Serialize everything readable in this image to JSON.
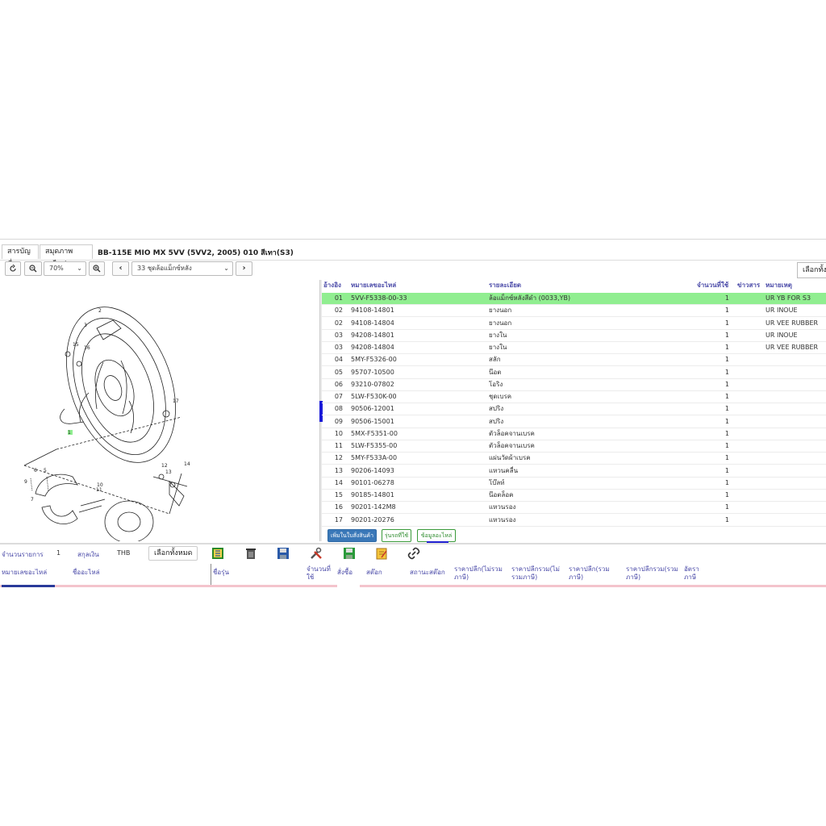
{
  "tabs": [
    "สารบัญชื่อ",
    "สมุดภาพอะไหล่"
  ],
  "model_title": "BB-115E MIO MX 5VV (5VV2, 2005) 010 สีเทา(S3)",
  "toolbar": {
    "zoom": "70%",
    "section": "33 ชุดล้อแม็กซ์หลัง",
    "select_all": "เลือกทั้งหมด"
  },
  "diagram_labels": [
    "2",
    "3",
    "15",
    "16",
    "1",
    "17",
    "12",
    "13",
    "14",
    "11",
    "10",
    "9",
    "6",
    "5",
    "7"
  ],
  "parts_headers": {
    "ref": "อ้างอิง",
    "part_no": "หมายเลขอะไหล่",
    "desc": "รายละเอียด",
    "qty": "จำนวนที่ใช้",
    "news": "ข่าวสาร",
    "note": "หมายเหตุ"
  },
  "parts": [
    {
      "ref": "01",
      "part_no": "5VV-F5338-00-33",
      "desc": "ล้อแม็กซ์หลังสีดำ (0033,YB)",
      "qty": "1",
      "note": "UR YB FOR S3",
      "highlight": true
    },
    {
      "ref": "02",
      "part_no": "94108-14801",
      "desc": "ยางนอก",
      "qty": "1",
      "note": "UR INOUE"
    },
    {
      "ref": "02",
      "part_no": "94108-14804",
      "desc": "ยางนอก",
      "qty": "1",
      "note": "UR VEE RUBBER"
    },
    {
      "ref": "03",
      "part_no": "94208-14801",
      "desc": "ยางใน",
      "qty": "1",
      "note": "UR INOUE"
    },
    {
      "ref": "03",
      "part_no": "94208-14804",
      "desc": "ยางใน",
      "qty": "1",
      "note": "UR VEE RUBBER"
    },
    {
      "ref": "04",
      "part_no": "5MY-F5326-00",
      "desc": "สลัก",
      "qty": "1",
      "note": ""
    },
    {
      "ref": "05",
      "part_no": "95707-10500",
      "desc": "น๊อต",
      "qty": "1",
      "note": ""
    },
    {
      "ref": "06",
      "part_no": "93210-07802",
      "desc": "โอริง",
      "qty": "1",
      "note": ""
    },
    {
      "ref": "07",
      "part_no": "5LW-F530K-00",
      "desc": "ชุดเบรค",
      "qty": "1",
      "note": ""
    },
    {
      "ref": "08",
      "part_no": "90506-12001",
      "desc": "สปริง",
      "qty": "1",
      "note": ""
    },
    {
      "ref": "09",
      "part_no": "90506-15001",
      "desc": "สปริง",
      "qty": "1",
      "note": ""
    },
    {
      "ref": "10",
      "part_no": "5MX-F5351-00",
      "desc": "ตัวล็อคจานเบรค",
      "qty": "1",
      "note": ""
    },
    {
      "ref": "11",
      "part_no": "5LW-F5355-00",
      "desc": "ตัวล็อคจานเบรค",
      "qty": "1",
      "note": ""
    },
    {
      "ref": "12",
      "part_no": "5MY-F533A-00",
      "desc": "แผ่นวัดผ้าเบรค",
      "qty": "1",
      "note": ""
    },
    {
      "ref": "13",
      "part_no": "90206-14093",
      "desc": "แหวนคลื่น",
      "qty": "1",
      "note": ""
    },
    {
      "ref": "14",
      "part_no": "90101-06278",
      "desc": "โบ๊ลท์",
      "qty": "1",
      "note": ""
    },
    {
      "ref": "15",
      "part_no": "90185-14801",
      "desc": "น๊อตล็อค",
      "qty": "1",
      "note": ""
    },
    {
      "ref": "16",
      "part_no": "90201-142M8",
      "desc": "แหวนรอง",
      "qty": "1",
      "note": ""
    },
    {
      "ref": "17",
      "part_no": "90201-20276",
      "desc": "แหวนรอง",
      "qty": "1",
      "note": ""
    }
  ],
  "actions": {
    "add_to_cart": "เพิ่มในใบสั่งสินค้า",
    "used_models": "รุ่นรถที่ใช้",
    "part_info": "ข้อมูลอะไหล่"
  },
  "cart": {
    "count_label": "จำนวนรายการ",
    "count": "1",
    "currency_label": "สกุลเงิน",
    "currency": "THB",
    "select_all": "เลือกทั้งหมด",
    "headers": {
      "part_no": "หมายเลขอะไหล่",
      "part_name": "ชื่ออะไหล่",
      "model": "ชื่อรุ่น",
      "qty_used": "จำนวนที่ใช้",
      "order": "สั่งซื้อ",
      "stock": "สต๊อก",
      "stock_status": "สถานะสต๊อก",
      "retail_excl": "ราคาปลีก(ไม่รวมภาษี)",
      "retail_total_excl": "ราคาปลีกรวม(ไม่รวมภาษี)",
      "retail_incl": "ราคาปลีก(รวมภาษี)",
      "retail_total_incl": "ราคาปลีกรวม(รวมภาษี)",
      "tax_rate": "อัตราภาษี"
    }
  },
  "icons": [
    "refresh-icon",
    "zoom-out-icon",
    "zoom-in-icon",
    "chevron-left-icon",
    "chevron-right-icon",
    "list-icon",
    "trash-icon",
    "save-icon",
    "tools-icon",
    "save-green-icon",
    "edit-note-icon",
    "link-icon"
  ],
  "colors": {
    "highlight_row": "#90ee90",
    "header_text": "#4a4aa8",
    "primary_button": "#3a78b8"
  }
}
